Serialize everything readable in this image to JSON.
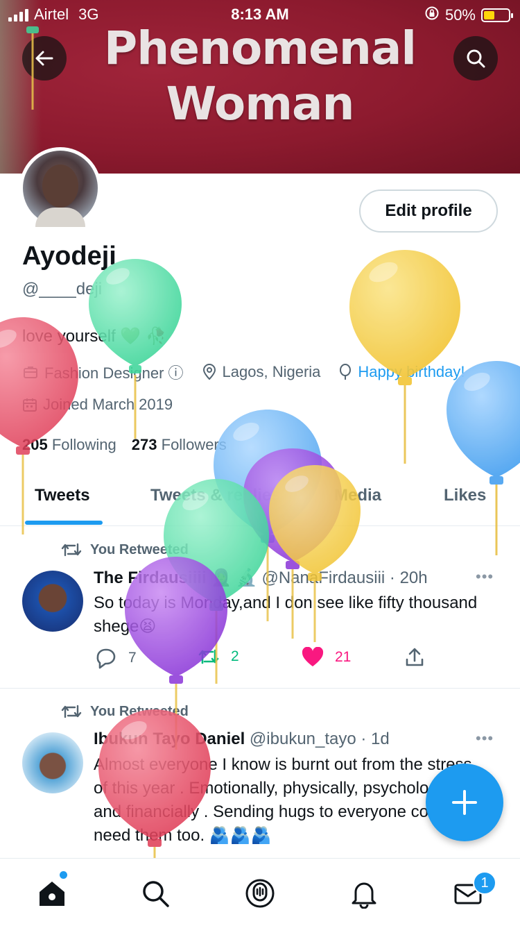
{
  "status_bar": {
    "carrier": "Airtel",
    "network": "3G",
    "time": "8:13 AM",
    "battery": "50%"
  },
  "banner": {
    "line1": "Phenomenal",
    "line2": "Woman"
  },
  "profile": {
    "edit_label": "Edit profile",
    "name": "Ayodeji",
    "handle": "@____deji",
    "bio": "love yourself 💚 🥀",
    "occupation": "Fashion Designer ⓘ",
    "location": "Lagos, Nigeria",
    "birthday": "Happy birthday!",
    "joined": "Joined March 2019",
    "following_count": "205",
    "following_label": "Following",
    "followers_count": "273",
    "followers_label": "Followers"
  },
  "tabs": [
    "Tweets",
    "Tweets & replies",
    "Media",
    "Likes"
  ],
  "tweets": [
    {
      "retweet_label": "You Retweeted",
      "author": "The Firdausiiii 🧕🏾 🔬",
      "handle": "@NanaFirdausiii",
      "time": "· 20h",
      "text": "So today is Monday,and I don see like fifty thousand shege😫",
      "replies": "7",
      "retweets": "2",
      "likes": "21"
    },
    {
      "retweet_label": "You Retweeted",
      "author": "Ibukun Tayo Daniel",
      "handle": "@ibukun_tayo",
      "time": "· 1d",
      "text": "Almost everyone I know is burnt out from the stress of this year . Emotionally, physically, psychologically and financially . Sending hugs to everyone cos I need them too. 🫂🫂🫂"
    }
  ],
  "more_label": "•••",
  "notifications_badge": "1",
  "colors": {
    "accent": "#1d9bf0",
    "like": "#f91880",
    "retweet": "#00ba7c",
    "banner": "#8c1a2e"
  },
  "icons": [
    "back-arrow-icon",
    "search-icon",
    "briefcase-icon",
    "location-pin-icon",
    "balloon-icon",
    "calendar-icon",
    "retweet-icon",
    "reply-icon",
    "heart-icon",
    "share-icon",
    "compose-plus-icon",
    "home-icon",
    "spaces-icon",
    "bell-icon",
    "mail-icon"
  ]
}
